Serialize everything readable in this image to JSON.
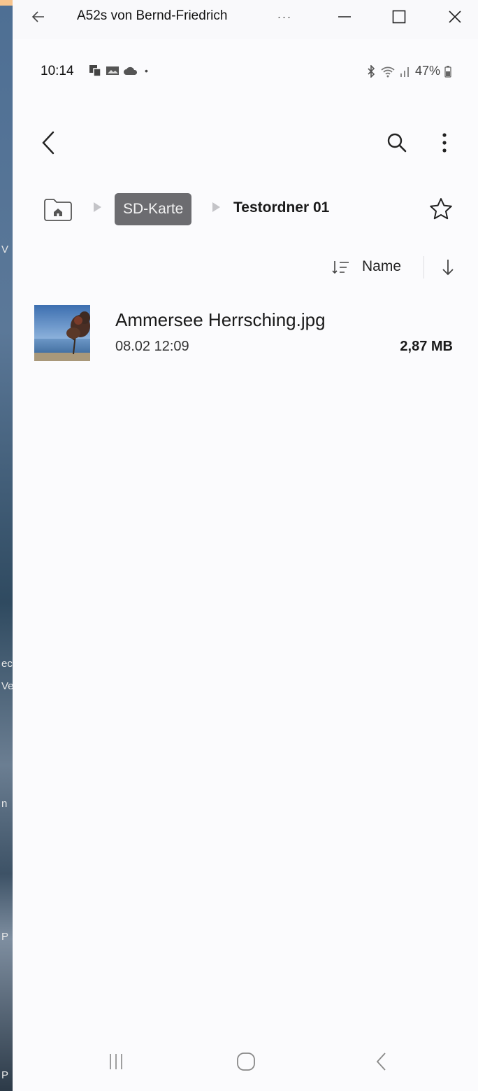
{
  "window": {
    "title": "A52s von Bernd-Friedrich",
    "more_label": "···"
  },
  "left_strip_fragments": [
    "V",
    "ec",
    "Ve",
    "n",
    "P",
    "P"
  ],
  "status_bar": {
    "time": "10:14",
    "notification_icons": [
      "screen-mirror-icon",
      "gallery-icon",
      "cloud-icon",
      "dot-icon"
    ],
    "dot": "•",
    "battery_text": "47%",
    "right_icons": [
      "bluetooth-icon",
      "wifi-icon",
      "signal-icon",
      "battery-icon"
    ]
  },
  "app_bar": {
    "icons": [
      "back-arrow-icon",
      "search-icon",
      "more-vertical-icon"
    ]
  },
  "breadcrumb": {
    "home_icon": "home-folder-icon",
    "items": [
      "SD-Karte",
      "Testordner 01"
    ],
    "favorite_icon": "star-outline-icon"
  },
  "sort": {
    "label": "Name",
    "type_icon": "sort-list-icon",
    "direction_icon": "arrow-down-icon"
  },
  "files": [
    {
      "name": "Ammersee Herrsching.jpg",
      "date": "08.02 12:09",
      "size": "2,87 MB",
      "thumbnail": "lake-tree-photo"
    }
  ],
  "nav_bar": {
    "icons": [
      "recent-apps-icon",
      "home-nav-icon",
      "back-nav-icon"
    ]
  },
  "colors": {
    "frame_accent": "#f7c58f",
    "breadcrumb_chip_bg": "#6c6c70",
    "screen_bg": "#fbfbfd"
  }
}
